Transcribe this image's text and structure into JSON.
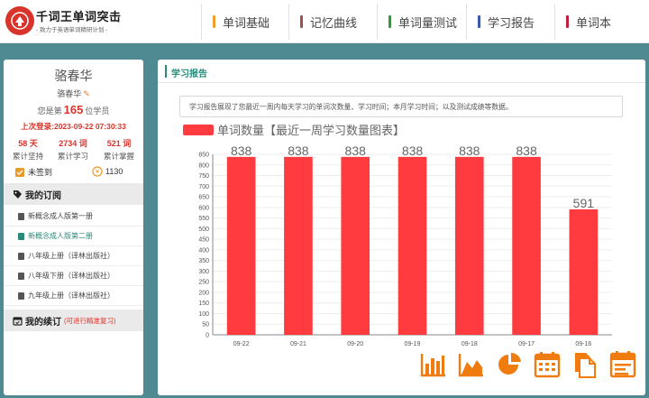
{
  "header": {
    "title": "千词王单词突击",
    "subtitle": "- 致力于英语单词精研计划 -",
    "nav": [
      {
        "label": "单词基础",
        "color": "#f0a030"
      },
      {
        "label": "记忆曲线",
        "color": "#a05050"
      },
      {
        "label": "单词量测试",
        "color": "#2e9a3a"
      },
      {
        "label": "学习报告",
        "color": "#3a5aa8"
      },
      {
        "label": "单词本",
        "color": "#c0203a"
      }
    ]
  },
  "user": {
    "name": "骆春华",
    "nickname": "骆春华",
    "rank_prefix": "您是第",
    "rank": "165",
    "rank_suffix": "位学员",
    "last_login": "上次登录:2023-09-22 07:30:33",
    "stats": [
      {
        "value": "58 天",
        "label": "累计坚持"
      },
      {
        "value": "2734 词",
        "label": "累计学习"
      },
      {
        "value": "521 词",
        "label": "累计掌握"
      }
    ],
    "sign_status": "未签到",
    "coins": "1130"
  },
  "subscriptions": {
    "title": "我的订阅",
    "items": [
      {
        "label": "新概念成人版第一册",
        "active": false
      },
      {
        "label": "新概念成人版第二册",
        "active": true
      },
      {
        "label": "八年级上册（译林出版社）",
        "active": false
      },
      {
        "label": "八年级下册（译林出版社）",
        "active": false
      },
      {
        "label": "九年级上册（译林出版社）",
        "active": false
      }
    ]
  },
  "renew": {
    "title": "我的续订",
    "note": "(可进行精准复习)"
  },
  "report": {
    "title": "学习报告",
    "description": "学习报告展现了您最近一周内每天学习的单词次数量、学习时间；本月学习时间；以及测试成绩等数据。"
  },
  "chart_data": {
    "type": "bar",
    "legend": "单词数量",
    "title": "【最近一周学习数量图表】",
    "categories": [
      "09-22",
      "09-21",
      "09-20",
      "09-19",
      "09-18",
      "09-17",
      "09-16"
    ],
    "values": [
      838,
      838,
      838,
      838,
      838,
      838,
      591
    ],
    "ylim": [
      0,
      850
    ],
    "yticks": [
      0,
      50,
      100,
      150,
      200,
      250,
      300,
      350,
      400,
      450,
      500,
      550,
      600,
      650,
      700,
      750,
      800,
      850
    ],
    "bar_color": "#ff3b3f"
  },
  "tool_icons": [
    "bar-chart-icon",
    "area-chart-icon",
    "pie-chart-icon",
    "calendar-icon",
    "copy-icon",
    "table-icon"
  ],
  "accent": "#2a8a7a",
  "tool_color": "#f07c10"
}
